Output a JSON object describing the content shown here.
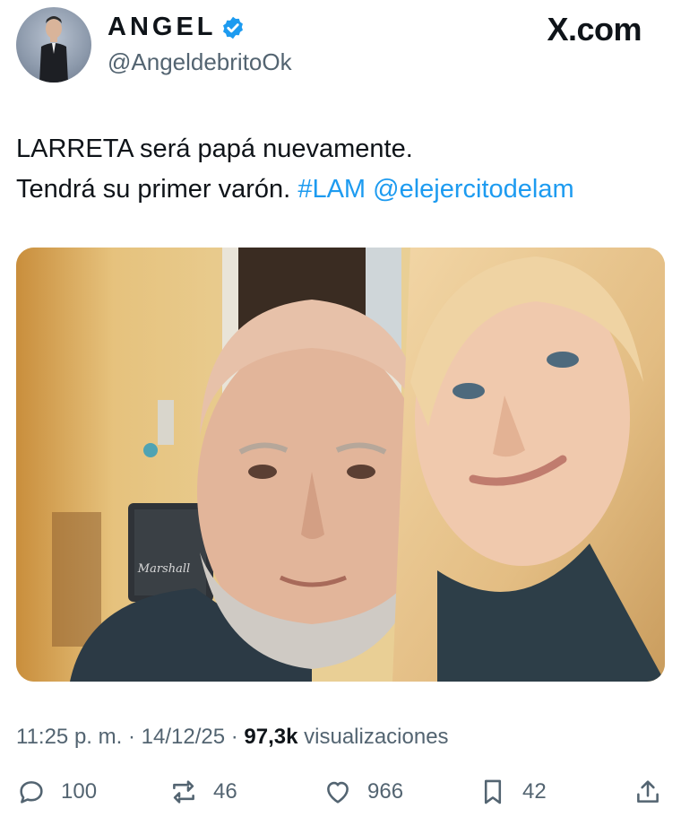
{
  "author": {
    "display_name": "ANGEL",
    "handle": "@AngeldebritoOk",
    "verified": true
  },
  "brand": "X.com",
  "tweet": {
    "line1": "LARRETA será papá nuevamente.",
    "line2_text": "Tendrá su primer varón.",
    "hashtag": "#LAM",
    "mention": "@elejercitodelam"
  },
  "meta": {
    "time": "11:25 p. m.",
    "separator": "·",
    "date": "14/12/25",
    "views_count": "97,3k",
    "views_label": "visualizaciones"
  },
  "actions": {
    "replies": "100",
    "reposts": "46",
    "likes": "966",
    "bookmarks": "42"
  },
  "media": {
    "amplifier_brand": "Marshall"
  },
  "colors": {
    "link": "#1d9bf0",
    "verified": "#1d9bf0",
    "muted": "#536471"
  }
}
